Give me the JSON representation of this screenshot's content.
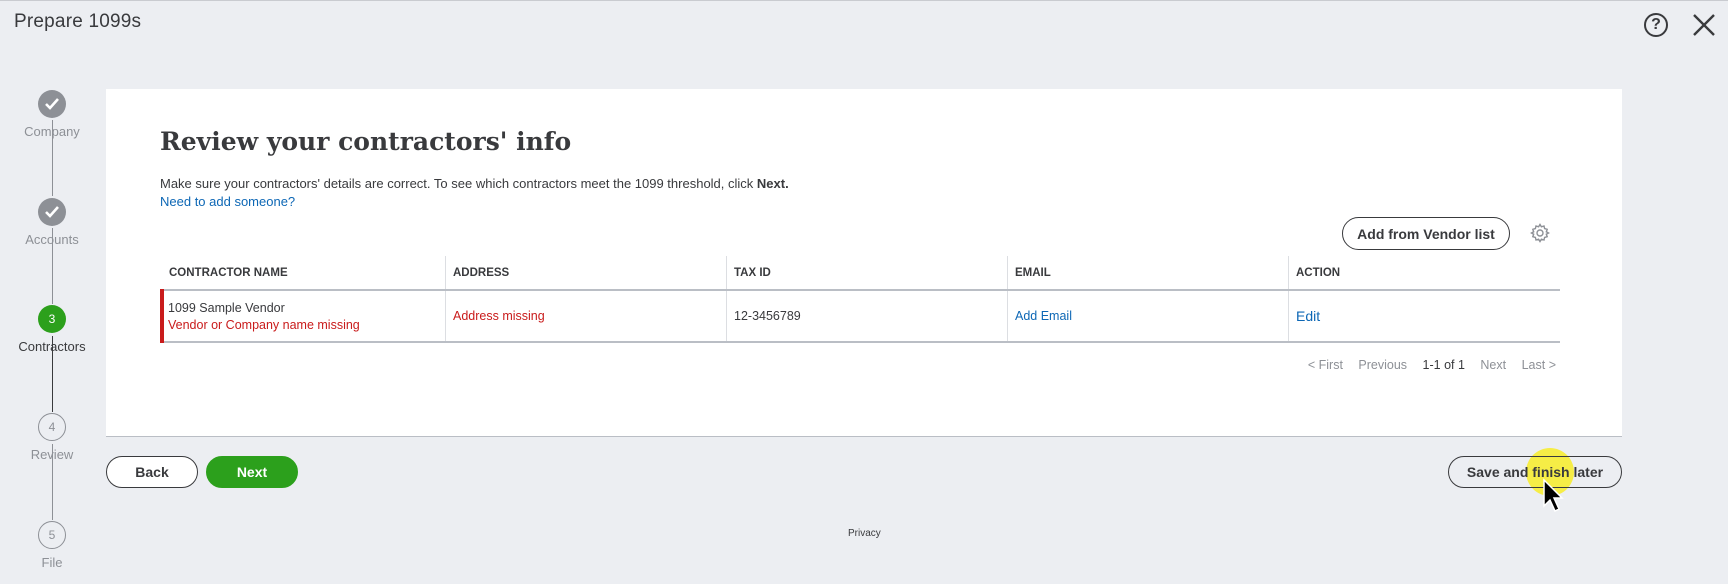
{
  "header": {
    "title": "Prepare 1099s",
    "help_icon": "help-icon",
    "close_icon": "close-icon"
  },
  "stepper": {
    "steps": [
      {
        "label": "Company",
        "state": "done"
      },
      {
        "label": "Accounts",
        "state": "done"
      },
      {
        "label": "Contractors",
        "number": "3",
        "state": "current"
      },
      {
        "label": "Review",
        "number": "4",
        "state": "future"
      },
      {
        "label": "File",
        "number": "5",
        "state": "future"
      }
    ]
  },
  "main": {
    "title": "Review your contractors' info",
    "description": "Make sure your contractors' details are correct. To see which contractors meet the 1099 threshold, click ",
    "description_bold": "Next.",
    "add_someone_link": "Need to add someone?",
    "add_vendor_button": "Add from Vendor list",
    "settings_icon": "gear-icon",
    "table": {
      "columns": [
        "CONTRACTOR NAME",
        "ADDRESS",
        "TAX ID",
        "EMAIL",
        "ACTION"
      ],
      "rows": [
        {
          "name": "1099 Sample Vendor",
          "name_error": "Vendor or Company name missing",
          "address": "Address missing",
          "tax_id": "12-3456789",
          "email": "Add Email",
          "action": "Edit"
        }
      ]
    },
    "pagination": {
      "first": "< First",
      "previous": "Previous",
      "range": "1-1 of 1",
      "next": "Next",
      "last": "Last >"
    }
  },
  "footer": {
    "back_button": "Back",
    "next_button": "Next",
    "save_button": "Save and finish later",
    "privacy_link": "Privacy"
  },
  "colors": {
    "accent_green": "#2ca01c",
    "error_red": "#c91b1b",
    "link_blue": "#0d67b5",
    "background": "#eceef2"
  }
}
